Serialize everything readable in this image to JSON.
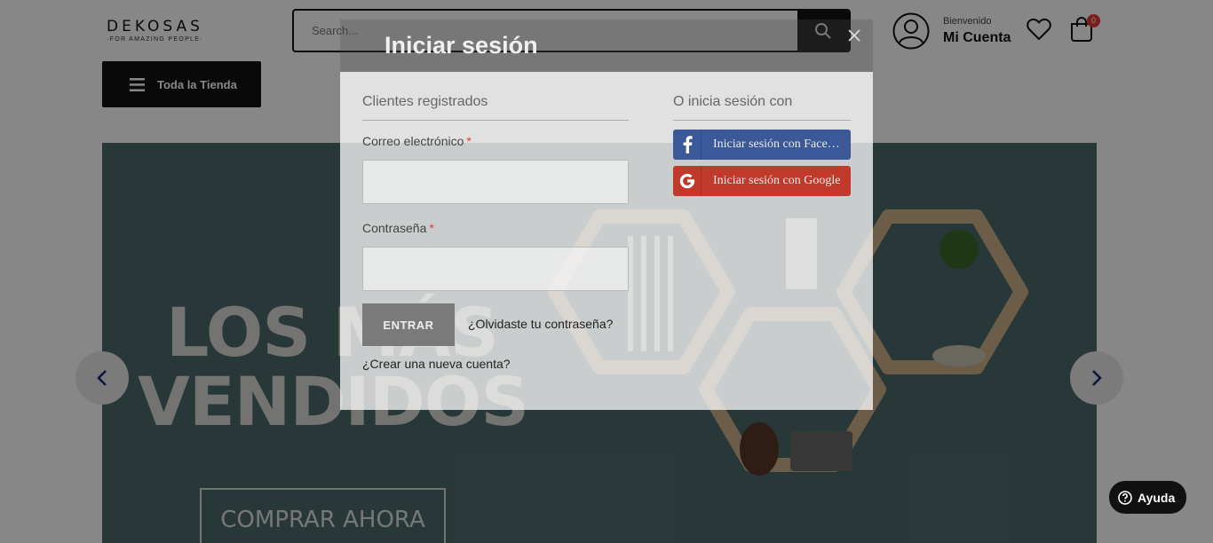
{
  "header": {
    "logo": {
      "main": "DEKOSAS",
      "tagline": "·FOR AMAZING PEOPLE·"
    },
    "search": {
      "placeholder": "Search..."
    },
    "account": {
      "greeting": "Bienvenido",
      "label": "Mi Cuenta"
    },
    "cart": {
      "count": "0"
    }
  },
  "nav": {
    "store_label": "Toda la Tienda"
  },
  "hero": {
    "title_line1": "LOS MÁS",
    "title_line2": "VENDIDOS",
    "cta": "COMPRAR AHORA"
  },
  "help": {
    "label": "Ayuda"
  },
  "modal": {
    "title": "Iniciar sesión",
    "registered": {
      "heading": "Clientes registrados",
      "email_label": "Correo electrónico",
      "password_label": "Contraseña",
      "required_mark": "*",
      "submit": "ENTRAR",
      "forgot": "¿Olvidaste tu contraseña?",
      "create": "¿Crear una nueva cuenta?"
    },
    "social": {
      "heading": "O inicia sesión con",
      "facebook": "Iniciar sesión con Facebook",
      "google": "Iniciar sesión con Google"
    }
  },
  "colors": {
    "overlay": "#000000",
    "facebook": "#3b5998",
    "google": "#c0392b",
    "hero_bg": "#4d6a6a",
    "badge": "#e53935"
  }
}
